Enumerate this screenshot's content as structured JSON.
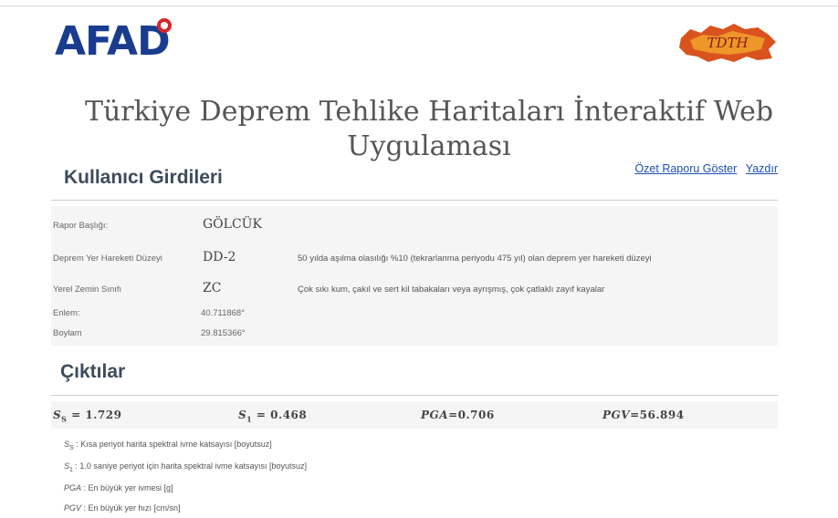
{
  "header": {
    "afad_logo_text": "AFAD",
    "tdth_logo_text": "TDTH",
    "title": "Türkiye Deprem Tehlike Haritaları İnteraktif Web Uygulaması"
  },
  "links": {
    "summary_report": "Özet Raporu Göster",
    "print": "Yazdır"
  },
  "inputs": {
    "section_title": "Kullanıcı Girdileri",
    "report_title_label": "Rapor Başlığı:",
    "report_title_value": "GÖLCÜK",
    "ground_motion_label": "Deprem Yer Hareketi Düzeyi",
    "ground_motion_value": "DD-2",
    "ground_motion_desc": "50 yılda aşılma olasılığı %10 (tekrarlanma periyodu 475 yıl) olan deprem yer hareketi düzeyi",
    "soil_class_label": "Yerel Zemin Sınıfı",
    "soil_class_value": "ZC",
    "soil_class_desc": "Çok sıkı kum, çakıl ve sert kil tabakaları veya ayrışmış, çok çatlaklı zayıf kayalar",
    "lat_label": "Enlem:",
    "lat_value": "40.711868°",
    "lon_label": "Boylam",
    "lon_value": "29.815366°"
  },
  "outputs": {
    "section_title": "Çıktılar",
    "ss_value": "1.729",
    "s1_value": "0.468",
    "pga_value": "0.706",
    "pgv_value": "56.894",
    "ss_desc": " : Kısa periyot harita spektral ivme katsayısı [boyutsuz]",
    "s1_desc": " : 1.0 saniye periyot için harita spektral ivme katsayısı [boyutsuz]",
    "pga_desc": " : En büyük yer ivmesi [g]",
    "pgv_desc": " : En büyük yer hızı [cm/sn]"
  },
  "colors": {
    "afad_blue": "#1a3c8f",
    "afad_red": "#d6262b",
    "link_blue": "#1d4fb5",
    "panel_bg": "#f5f5f5"
  }
}
